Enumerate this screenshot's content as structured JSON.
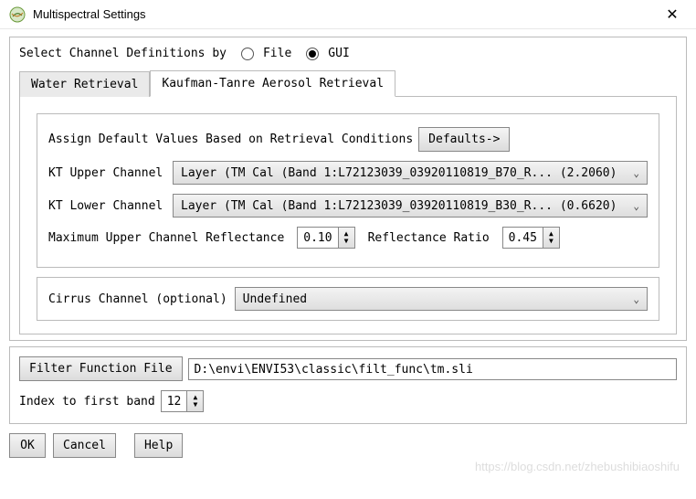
{
  "title": "Multispectral Settings",
  "icon": "app-icon",
  "selectLabel": "Select Channel Definitions by",
  "radios": {
    "file": "File",
    "gui": "GUI"
  },
  "tabs": {
    "water": "Water Retrieval",
    "kt": "Kaufman-Tanre Aerosol Retrieval"
  },
  "kt": {
    "assignLabel": "Assign Default Values Based on Retrieval Conditions",
    "defaultsBtn": "Defaults->",
    "upperLabel": "KT Upper Channel",
    "upperValue": "Layer (TM Cal (Band 1:L72123039_03920110819_B70_R... (2.2060)",
    "lowerLabel": "KT Lower Channel",
    "lowerValue": "Layer (TM Cal (Band 1:L72123039_03920110819_B30_R... (0.6620)",
    "maxReflLabel": "Maximum Upper Channel Reflectance",
    "maxReflValue": "0.10",
    "reflRatioLabel": "Reflectance Ratio",
    "reflRatioValue": "0.45"
  },
  "cirrus": {
    "label": "Cirrus Channel (optional)",
    "value": "Undefined"
  },
  "filter": {
    "btn": "Filter Function File",
    "path": "D:\\envi\\ENVI53\\classic\\filt_func\\tm.sli"
  },
  "indexLabel": "Index to first band",
  "indexValue": "12",
  "buttons": {
    "ok": "OK",
    "cancel": "Cancel",
    "help": "Help"
  },
  "watermark": "https://blog.csdn.net/zhebushibiaoshifu"
}
